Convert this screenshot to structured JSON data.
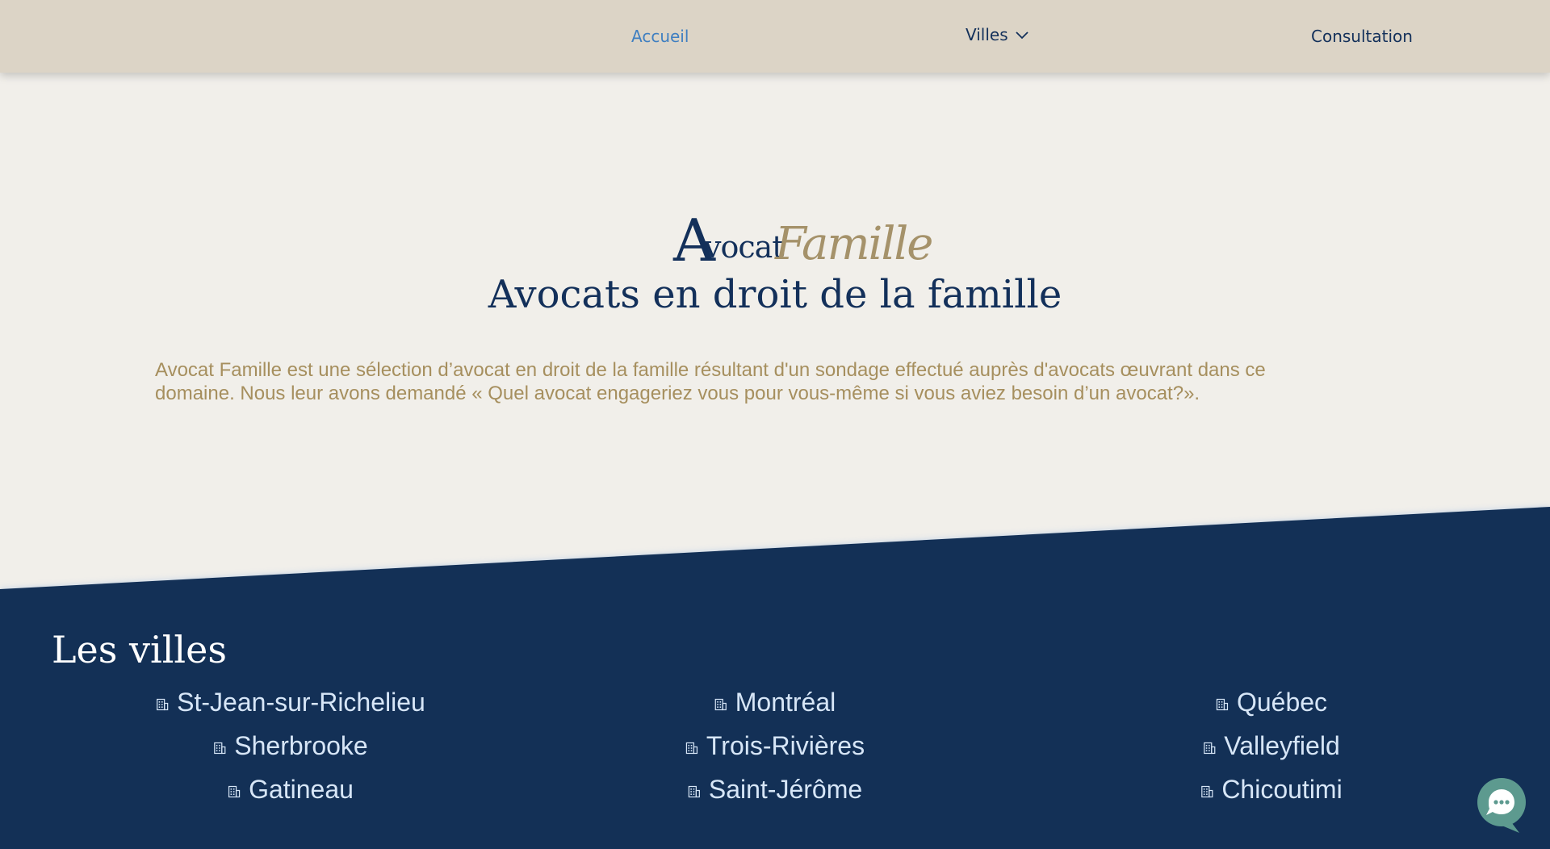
{
  "nav": {
    "items": [
      {
        "label": "Accueil",
        "active": true
      },
      {
        "label": "Villes",
        "has_dropdown": true,
        "icon": "chevron-down-icon"
      },
      {
        "label": "Consultation"
      }
    ]
  },
  "logo": {
    "part1_initial": "A",
    "part1_rest": "vocat",
    "part2": "Famille"
  },
  "hero": {
    "title": "Avocats en droit de la famille",
    "intro": "Avocat Famille est une sélection d’avocat en droit de la famille résultant d'un sondage effectué auprès d'avocats œuvrant dans ce domaine. Nous leur avons demandé « Quel avocat engageriez vous pour vous-même si vous aviez besoin d’un avocat?»."
  },
  "villes": {
    "title": "Les villes",
    "icon": "building-icon",
    "columns": [
      [
        "St-Jean-sur-Richelieu",
        "Sherbrooke",
        "Gatineau"
      ],
      [
        "Montréal",
        "Trois-Rivières",
        "Saint-Jérôme"
      ],
      [
        "Québec",
        "Valleyfield",
        "Chicoutimi"
      ]
    ]
  },
  "chat": {
    "icon": "chat-bubble-icon"
  },
  "colors": {
    "header_bg": "#dcd4c6",
    "page_bg": "#f1efea",
    "navy": "#13305a",
    "gold": "#a68f5e",
    "link_active": "#3f7fc1",
    "city_text": "#d7e6f7",
    "chat": "#5d9a8f"
  }
}
